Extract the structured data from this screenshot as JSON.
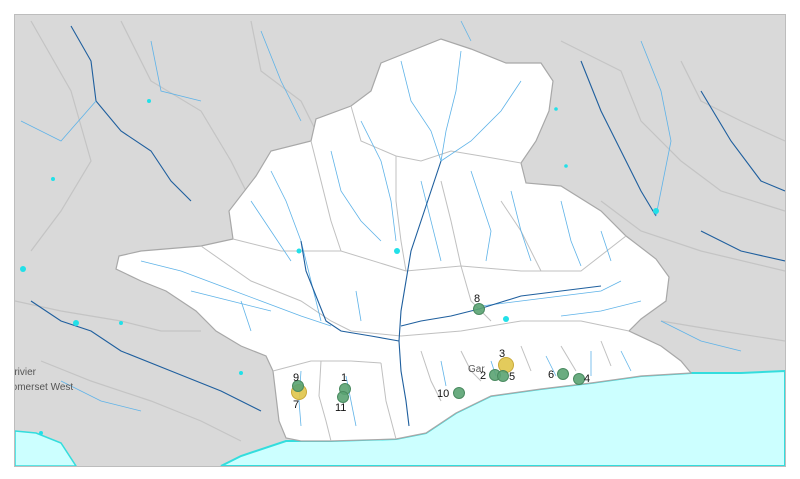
{
  "map": {
    "colors": {
      "background": "#d9d9d9",
      "catchment": "#ffffff",
      "sea": "#ccffff",
      "coastline": "#33dddd",
      "major_river": "#1f5f9e",
      "minor_river": "#5fb3e8",
      "waterbody": "#22e0e8",
      "subcatchment_border": "#b9b9b9",
      "site_green": "#5aa372",
      "site_yellow": "#e0c54a"
    },
    "town_labels": [
      "sterivier",
      "Somerset West",
      "Gar"
    ],
    "sites": [
      {
        "id": "1",
        "label": "1",
        "type": "green"
      },
      {
        "id": "2",
        "label": "2",
        "type": "green"
      },
      {
        "id": "3",
        "label": "3",
        "type": "yellow"
      },
      {
        "id": "4",
        "label": "4",
        "type": "green"
      },
      {
        "id": "5",
        "label": "5",
        "type": "green"
      },
      {
        "id": "6",
        "label": "6",
        "type": "green"
      },
      {
        "id": "7",
        "label": "7",
        "type": "yellow"
      },
      {
        "id": "8",
        "label": "8",
        "type": "green"
      },
      {
        "id": "9",
        "label": "9",
        "type": "green"
      },
      {
        "id": "10",
        "label": "10",
        "type": "green"
      },
      {
        "id": "11",
        "label": "11",
        "type": "green"
      }
    ]
  }
}
